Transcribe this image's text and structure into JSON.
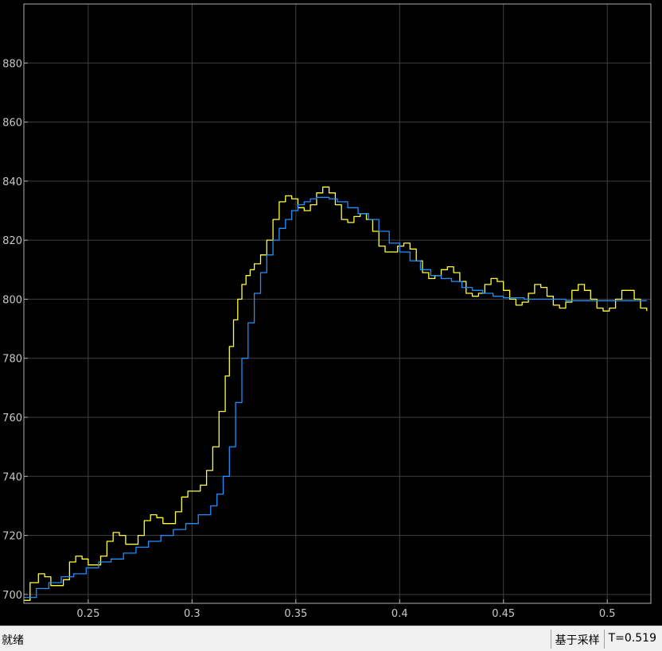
{
  "status": {
    "left_text": "就绪",
    "sampling_text": "基于采样",
    "time_text": "T=0.519"
  },
  "colors": {
    "background": "#000000",
    "grid": "#404040",
    "axes": "#b0b0b0",
    "series1": "#ffff33",
    "series2": "#1e90ff"
  },
  "chart_data": {
    "type": "line",
    "title": "",
    "xlabel": "",
    "ylabel": "",
    "xlim": [
      0.219,
      0.521
    ],
    "ylim": [
      697,
      900
    ],
    "grid": true,
    "xticks": [
      0.25,
      0.3,
      0.35,
      0.4,
      0.45,
      0.5
    ],
    "xtick_labels": [
      "0.25",
      "0.3",
      "0.35",
      "0.4",
      "0.45",
      "0.5"
    ],
    "yticks": [
      700,
      720,
      740,
      760,
      780,
      800,
      820,
      840,
      860,
      880
    ],
    "ytick_labels": [
      "700",
      "720",
      "740",
      "760",
      "780",
      "800",
      "820",
      "840",
      "860",
      "880"
    ],
    "series": [
      {
        "color": "#ffff33",
        "x": [
          0.219,
          0.222,
          0.226,
          0.229,
          0.232,
          0.235,
          0.238,
          0.241,
          0.244,
          0.247,
          0.25,
          0.253,
          0.256,
          0.259,
          0.262,
          0.265,
          0.268,
          0.271,
          0.274,
          0.277,
          0.28,
          0.283,
          0.286,
          0.289,
          0.292,
          0.295,
          0.298,
          0.301,
          0.304,
          0.307,
          0.31,
          0.313,
          0.316,
          0.318,
          0.32,
          0.322,
          0.324,
          0.326,
          0.328,
          0.33,
          0.333,
          0.336,
          0.339,
          0.342,
          0.345,
          0.348,
          0.351,
          0.354,
          0.357,
          0.36,
          0.363,
          0.366,
          0.369,
          0.372,
          0.375,
          0.378,
          0.381,
          0.384,
          0.387,
          0.39,
          0.393,
          0.396,
          0.399,
          0.402,
          0.405,
          0.408,
          0.411,
          0.414,
          0.417,
          0.42,
          0.423,
          0.426,
          0.429,
          0.432,
          0.435,
          0.438,
          0.441,
          0.444,
          0.447,
          0.45,
          0.453,
          0.456,
          0.459,
          0.462,
          0.465,
          0.468,
          0.471,
          0.474,
          0.477,
          0.48,
          0.483,
          0.486,
          0.489,
          0.492,
          0.495,
          0.498,
          0.501,
          0.504,
          0.507,
          0.51,
          0.513,
          0.516,
          0.519
        ],
        "y": [
          698,
          704,
          707,
          706,
          703,
          703,
          705,
          711,
          713,
          712,
          710,
          710,
          713,
          718,
          721,
          720,
          717,
          717,
          720,
          725,
          727,
          726,
          724,
          724,
          728,
          733,
          735,
          735,
          737,
          742,
          750,
          762,
          774,
          784,
          793,
          800,
          805,
          808,
          810,
          812,
          815,
          820,
          827,
          833,
          835,
          834,
          831,
          830,
          832,
          836,
          838,
          836,
          832,
          827,
          826,
          828,
          829,
          827,
          823,
          818,
          816,
          816,
          818,
          819,
          817,
          813,
          809,
          807,
          808,
          810,
          811,
          809,
          806,
          802,
          801,
          802,
          805,
          807,
          806,
          803,
          800,
          798,
          799,
          802,
          805,
          804,
          801,
          798,
          797,
          799,
          803,
          805,
          803,
          800,
          797,
          796,
          797,
          800,
          803,
          803,
          800,
          797,
          796
        ]
      },
      {
        "color": "#1e90ff",
        "x": [
          0.219,
          0.225,
          0.231,
          0.237,
          0.243,
          0.249,
          0.255,
          0.261,
          0.267,
          0.273,
          0.279,
          0.285,
          0.291,
          0.297,
          0.303,
          0.309,
          0.312,
          0.315,
          0.318,
          0.321,
          0.324,
          0.327,
          0.33,
          0.333,
          0.336,
          0.339,
          0.342,
          0.345,
          0.348,
          0.351,
          0.354,
          0.357,
          0.36,
          0.363,
          0.366,
          0.37,
          0.375,
          0.38,
          0.385,
          0.39,
          0.395,
          0.4,
          0.405,
          0.41,
          0.415,
          0.42,
          0.425,
          0.43,
          0.435,
          0.44,
          0.445,
          0.45,
          0.46,
          0.47,
          0.48,
          0.49,
          0.5,
          0.51,
          0.519
        ],
        "y": [
          699,
          702,
          704,
          706,
          707,
          709,
          711,
          712,
          714,
          716,
          718,
          720,
          722,
          724,
          727,
          730,
          734,
          740,
          750,
          765,
          780,
          792,
          802,
          809,
          815,
          820,
          824,
          827,
          830,
          832,
          833,
          834,
          834.5,
          834.5,
          834,
          833,
          831,
          829,
          827,
          823,
          819,
          816,
          813,
          810,
          808,
          807,
          806,
          804,
          803,
          802,
          801,
          800.5,
          800,
          800,
          799.5,
          799.5,
          799.5,
          799.5,
          799.5
        ]
      }
    ]
  }
}
